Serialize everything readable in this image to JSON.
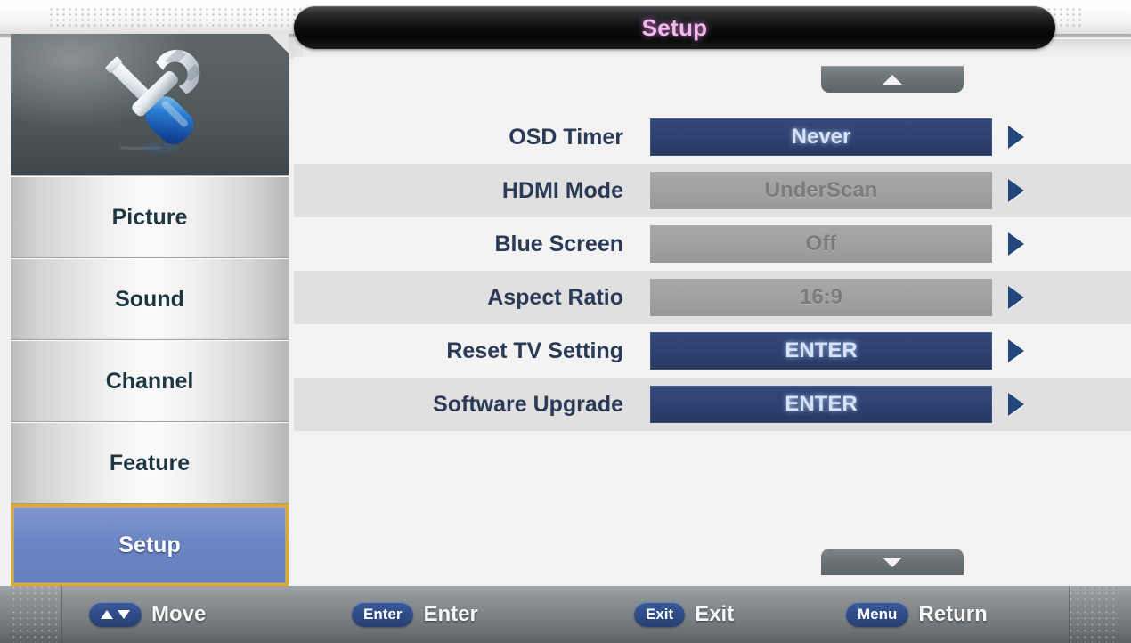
{
  "header": {
    "title": "Setup"
  },
  "sidebar": {
    "icon": "tools-icon",
    "items": [
      {
        "label": "Picture",
        "selected": false
      },
      {
        "label": "Sound",
        "selected": false
      },
      {
        "label": "Channel",
        "selected": false
      },
      {
        "label": "Feature",
        "selected": false
      },
      {
        "label": "Setup",
        "selected": true
      }
    ]
  },
  "content": {
    "scroll_up": "scroll-up-arrow",
    "scroll_down": "scroll-down-arrow",
    "rows": [
      {
        "label": "OSD Timer",
        "value": "Never",
        "state": "active"
      },
      {
        "label": "HDMI Mode",
        "value": "UnderScan",
        "state": "disabled"
      },
      {
        "label": "Blue Screen",
        "value": "Off",
        "state": "disabled"
      },
      {
        "label": "Aspect Ratio",
        "value": "16:9",
        "state": "disabled"
      },
      {
        "label": "Reset TV Setting",
        "value": "ENTER",
        "state": "active"
      },
      {
        "label": "Software Upgrade",
        "value": "ENTER",
        "state": "active"
      }
    ]
  },
  "status_bar": {
    "hints": [
      {
        "key": "",
        "action": "Move",
        "icon": "up-down-arrows"
      },
      {
        "key": "Enter",
        "action": "Enter",
        "icon": ""
      },
      {
        "key": "Exit",
        "action": "Exit",
        "icon": ""
      },
      {
        "key": "Menu",
        "action": "Return",
        "icon": ""
      }
    ]
  },
  "colors": {
    "title_text": "#f4b8ef",
    "active_value_bg": "#2d4171",
    "active_value_text": "#d6e2f8",
    "disabled_value_bg": "#a0a0a0",
    "disabled_value_text": "#7b7b7b",
    "label_text": "#2b3a56",
    "selected_nav_bg": "#6b84c2",
    "selected_nav_border": "#e6a919",
    "arrow": "#23467c",
    "key_pill": "#2f4b87"
  }
}
